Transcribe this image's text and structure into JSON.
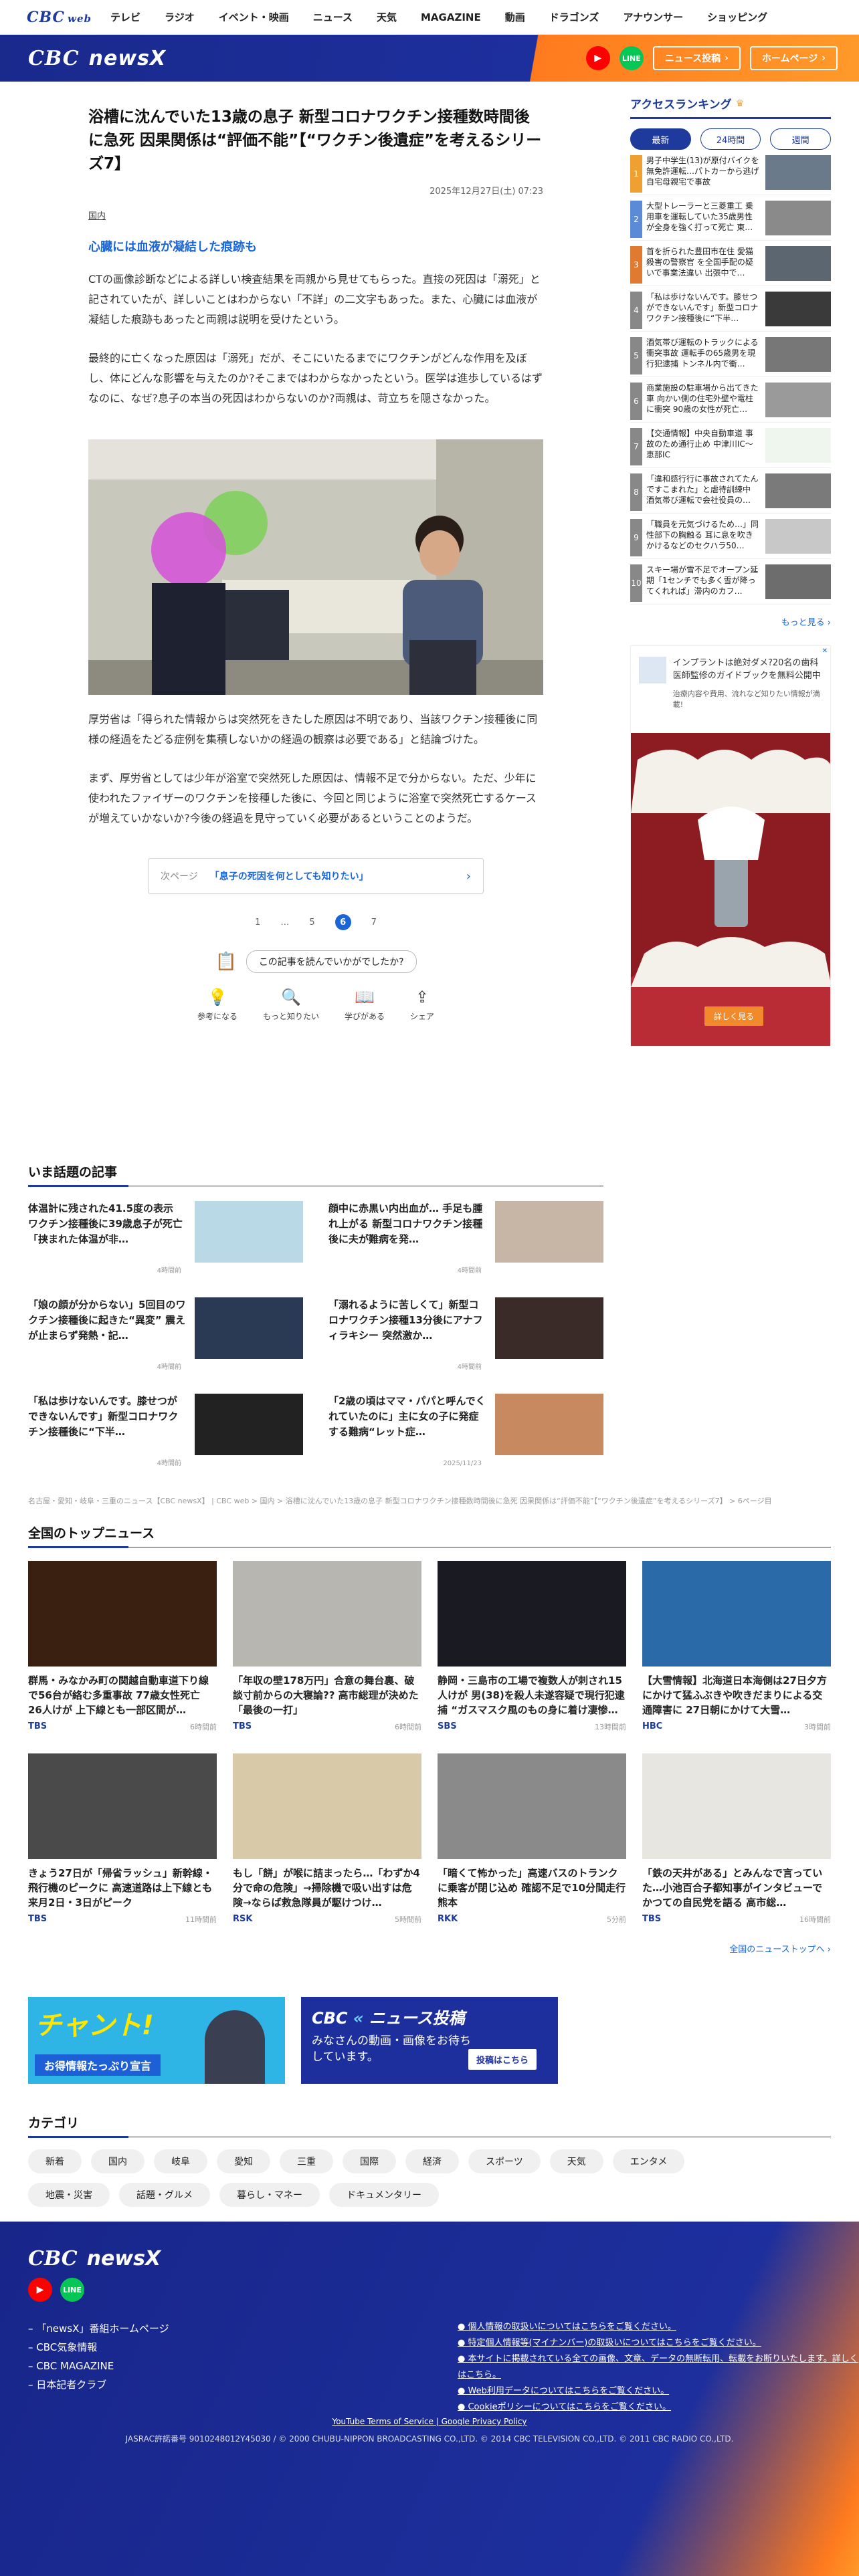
{
  "topnav": {
    "logo": "CBC",
    "logo_sub": "web",
    "items": [
      "テレビ",
      "ラジオ",
      "イベント・映画",
      "ニュース",
      "天気",
      "MAGAZINE",
      "動画",
      "ドラゴンズ",
      "アナウンサー",
      "ショッピング"
    ]
  },
  "header": {
    "brand_cbc": "CBC",
    "brand_news": "newsX",
    "post_btn": "ニュース投稿",
    "home_btn": "ホームページ"
  },
  "article": {
    "title": "浴槽に沈んでいた13歳の息子 新型コロナワクチン接種数時間後に急死 因果関係は“評価不能”【“ワクチン後遺症”を考えるシリーズ7】",
    "date": "2025年12月27日(土) 07:23",
    "category": "国内",
    "subhead": "心臓には血液が凝結した痕跡も",
    "paras": [
      "CTの画像診断などによる詳しい検査結果を両親から見せてもらった。直接の死因は「溺死」と記されていたが、詳しいことはわからない「不詳」の二文字もあった。また、心臓には血液が凝結した痕跡もあったと両親は説明を受けたという。",
      "最終的に亡くなった原因は「溺死」だが、そこにいたるまでにワクチンがどんな作用を及ぼし、体にどんな影響を与えたのか?そこまではわからなかったという。医学は進歩しているはずなのに、なぜ?息子の本当の死因はわからないのか?両親は、苛立ちを隠さなかった。",
      "厚労省は「得られた情報からは突然死をきたした原因は不明であり、当該ワクチン接種後に同様の経過をたどる症例を集積しないかの経過の観察は必要である」と結論づけた。",
      "まず、厚労省としては少年が浴室で突然死した原因は、情報不足で分からない。ただ、少年に使われたファイザーのワクチンを接種した後に、今回と同じように浴室で突然死亡するケースが増えていかないか?今後の経過を見守っていく必要があるということのようだ。"
    ],
    "next_label": "次ページ",
    "next_title": "「息子の死因を何としても知りたい」",
    "pager": [
      "1",
      "…",
      "5",
      "6",
      "7"
    ],
    "feedback_q": "この記事を読んでいかがでしたか?",
    "reactions": [
      {
        "icon": "lightbulb-icon",
        "label": "参考になる"
      },
      {
        "icon": "search-icon",
        "label": "もっと知りたい"
      },
      {
        "icon": "book-icon",
        "label": "学びがある"
      },
      {
        "icon": "share-icon",
        "label": "シェア"
      }
    ]
  },
  "ranking": {
    "title": "アクセスランキング",
    "tabs": [
      "最新",
      "24時間",
      "週間"
    ],
    "items": [
      {
        "n": "1",
        "text": "男子中学生(13)が原付バイクを無免許運転…パトカーから逃げ自宅母親宅で事故",
        "color": "#f0a030"
      },
      {
        "n": "2",
        "text": "大型トレーラーと三菱重工 乗用車を運転していた35歳男性が全身を強く打って死亡 東…",
        "color": "#5b8ad6"
      },
      {
        "n": "3",
        "text": "首を折られた豊田市在住 愛猫殺害の警察官 を全国手配の疑いで事業法違い 出張中で…",
        "color": "#e07a30"
      },
      {
        "n": "4",
        "text": "「私は歩けないんです。膝せつができないんです」新型コロナワクチン接種後に“下半…",
        "color": "#888"
      },
      {
        "n": "5",
        "text": "酒気帯び運転のトラックによる衝突事故 運転手の65歳男を現行犯逮捕 トンネル内で衝…",
        "color": "#888"
      },
      {
        "n": "6",
        "text": "商業施設の駐車場から出てきた車 向かい側の住宅外壁や電柱に衝突 90歳の女性が死亡…",
        "color": "#888"
      },
      {
        "n": "7",
        "text": "【交通情報】中央自動車道 事故のため通行止め 中津川IC～恵那IC",
        "color": "#888"
      },
      {
        "n": "8",
        "text": "「違和感行行に事故されてたんですこまれた」と虐待訓練中 酒気帯び運転で会社役員の…",
        "color": "#888"
      },
      {
        "n": "9",
        "text": "「職員を元気づけるため…」同性部下の胸触る 耳に息を吹きかけるなどのセクハラ50…",
        "color": "#888"
      },
      {
        "n": "10",
        "text": "スキー場が雪不足でオープン延期「1センチでも多く雪が降ってくれれば」滞内のカフ…",
        "color": "#888"
      }
    ],
    "more": "もっと見る"
  },
  "ad": {
    "headline": "インプラントは絶対ダメ?20名の歯科医師監修のガイドブックを無料公開中",
    "sub": "治療内容や費用、流れなど知りたい情報が満載!",
    "cta": "詳しく見る"
  },
  "hot": {
    "title": "いま話題の記事",
    "items": [
      {
        "text": "体温計に残された41.5度の表示 ワクチン接種後に39歳息子が死亡「挟まれた体温が非…",
        "time": "4時間前"
      },
      {
        "text": "顔中に赤黒い内出血が… 手足も腫れ上がる 新型コロナワクチン接種後に夫が難病を発…",
        "time": "4時間前"
      },
      {
        "text": "「娘の顔が分からない」5回目のワクチン接種後に起きた“異変” 震えが止まらず発熱・記…",
        "time": "4時間前"
      },
      {
        "text": "「溺れるように苦しくて」新型コロナワクチン接種13分後にアナフィラキシー 突然激か…",
        "time": "4時間前"
      },
      {
        "text": "「私は歩けないんです。膝せつができないんです」新型コロナワクチン接種後に“下半…",
        "time": "4時間前"
      },
      {
        "text": "「2歳の頃はママ・パパと呼んでくれていたのに」主に女の子に発症する難病“レット症…",
        "time": "2025/11/23"
      }
    ]
  },
  "breadcrumb": "名古屋・愛知・岐阜・三重のニュース【CBC newsX】 | CBC web > 国内 > 浴槽に沈んでいた13歳の息子 新型コロナワクチン接種数時間後に急死 因果関係は“評価不能”【“ワクチン後遺症”を考えるシリーズ7】 > 6ページ目",
  "topnews": {
    "title": "全国のトップニュース",
    "items": [
      {
        "text": "群馬・みなかみ町の関越自動車道下り線で56台が絡む多重事故 77歳女性死亡 26人けが 上下線とも一部区間が…",
        "src": "TBS",
        "time": "6時間前"
      },
      {
        "text": "「年収の壁178万円」合意の舞台裏、破談寸前からの大寝論?? 高市総理が決めた「最後の一打」",
        "src": "TBS",
        "time": "6時間前"
      },
      {
        "text": "静岡・三島市の工場で複数人が刺され15人けが 男(38)を殺人未遂容疑で現行犯逮捕 “ガスマスク風のもの身に着け凄惨…",
        "src": "SBS",
        "time": "13時間前"
      },
      {
        "text": "【大雪情報】北海道日本海側は27日夕方にかけて猛ふぶきや吹きだまりによる交通障害に 27日朝にかけて大雪…",
        "src": "HBC",
        "time": "3時間前"
      },
      {
        "text": "きょう27日が「帰省ラッシュ」新幹線・飛行機のピークに 高速道路は上下線とも来月2日・3日がピーク",
        "src": "TBS",
        "time": "11時間前"
      },
      {
        "text": "もし「餅」が喉に詰まったら…「わずか4分で命の危険」→掃除機で吸い出すは危険→ならば救急隊員が駆けつけ…",
        "src": "RSK",
        "time": "5時間前"
      },
      {
        "text": "「暗くて怖かった」高速バスのトランクに乗客が閉じ込め 確認不足で10分間走行 熊本",
        "src": "RKK",
        "time": "5分前"
      },
      {
        "text": "「鉄の天井がある」とみんなで言っていた…小池百合子都知事がインタビューでかつての自民党を語る 高市総…",
        "src": "TBS",
        "time": "16時間前"
      }
    ],
    "more": "全国のニューストップへ"
  },
  "banners": {
    "chant_title": "チャント!",
    "chant_sub": "お得情報たっぷり宣言",
    "post_title": "ニュース投稿",
    "post_sub": "みなさんの動画・画像をお待ちしています。",
    "post_btn": "投稿はこちら"
  },
  "categories": {
    "title": "カテゴリ",
    "items": [
      "新着",
      "国内",
      "岐阜",
      "愛知",
      "三重",
      "国際",
      "経済",
      "スポーツ",
      "天気",
      "エンタメ",
      "地震・災害",
      "話題・グルメ",
      "暮らし・マネー",
      "ドキュメンタリー"
    ]
  },
  "footer": {
    "brand": "newsX",
    "links": [
      "「newsX」番組ホームページ",
      "CBC気象情報",
      "CBC MAGAZINE",
      "日本記者クラブ"
    ],
    "policies": [
      "個人情報の取扱いについてはこちらをご覧ください。",
      "特定個人情報等(マイナンバー)の取扱いについてはこちらをご覧ください。",
      "本サイトに掲載されている全ての画像、文章、データの無断転用、転載をお断りいたします。詳しくはこちら。",
      "Web利用データについてはこちらをご覧ください。",
      "Cookieポリシーについてはこちらをご覧ください。"
    ],
    "terms": "YouTube Terms of Service | Google Privacy Policy",
    "copyright": "JASRAC許諾番号 9010248012Y45030 / © 2000 CHUBU-NIPPON BROADCASTING CO.,LTD. © 2014 CBC TELEVISION CO.,LTD. © 2011 CBC RADIO CO.,LTD."
  }
}
